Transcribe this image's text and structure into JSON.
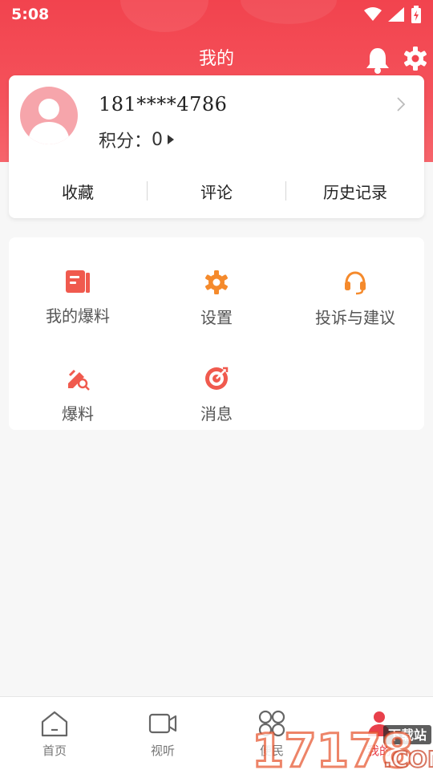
{
  "status_bar": {
    "time": "5:08"
  },
  "header": {
    "title": "我的"
  },
  "profile": {
    "phone": "181****4786",
    "points_label": "积分：",
    "points_value": "0"
  },
  "quick_links": [
    {
      "label": "收藏"
    },
    {
      "label": "评论"
    },
    {
      "label": "历史记录"
    }
  ],
  "menu": [
    {
      "label": "我的爆料",
      "icon": "document-icon"
    },
    {
      "label": "设置",
      "icon": "gear-icon"
    },
    {
      "label": "投诉与建议",
      "icon": "headset-icon"
    },
    {
      "label": "爆料",
      "icon": "tip-off-icon"
    },
    {
      "label": "消息",
      "icon": "target-icon"
    }
  ],
  "bottom_nav": [
    {
      "label": "首页",
      "icon": "home-icon"
    },
    {
      "label": "视听",
      "icon": "video-icon"
    },
    {
      "label": "便民",
      "icon": "grid-circles-icon"
    },
    {
      "label": "我的",
      "icon": "user-icon",
      "active": true
    }
  ],
  "colors": {
    "accent": "#f2434e",
    "menu_red": "#f05a4e",
    "menu_orange": "#f58a2c",
    "background": "#f7f7f7"
  },
  "watermark": {
    "text_a": "下载站",
    "text_b": "17178",
    "text_c": ".COM"
  }
}
